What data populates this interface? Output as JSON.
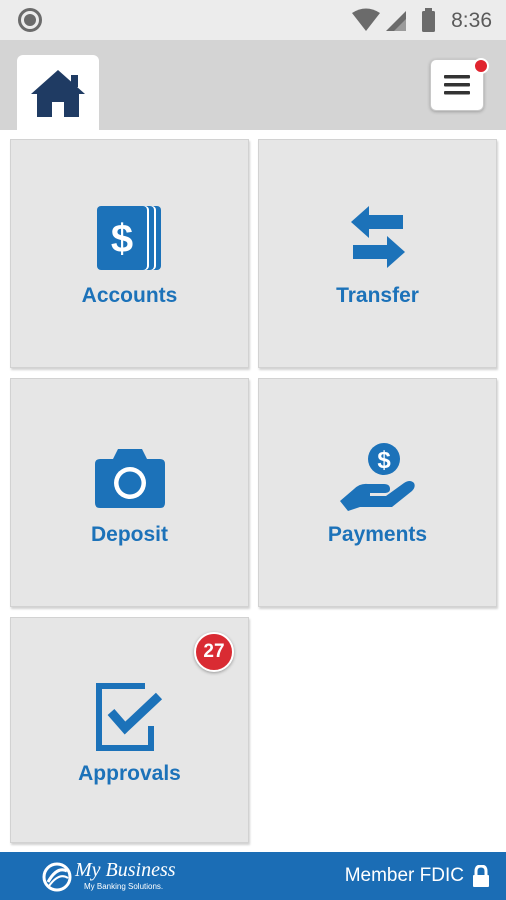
{
  "status_bar": {
    "time": "8:36"
  },
  "nav": {
    "home_icon": "home-icon",
    "menu_icon": "hamburger-menu-icon",
    "menu_notification": true
  },
  "tiles": [
    {
      "label": "Accounts",
      "icon": "dollar-accounts-icon"
    },
    {
      "label": "Transfer",
      "icon": "transfer-arrows-icon"
    },
    {
      "label": "Deposit",
      "icon": "camera-icon"
    },
    {
      "label": "Payments",
      "icon": "hand-dollar-icon"
    },
    {
      "label": "Approvals",
      "icon": "checkbox-icon",
      "badge": "27"
    }
  ],
  "footer": {
    "logo_name": "My Business",
    "logo_tagline": "My Banking Solutions.",
    "member_text": "Member FDIC",
    "lock_icon": "lock-icon"
  },
  "colors": {
    "accent": "#1c72b9",
    "footer": "#1b6db5",
    "badge": "#d92b33",
    "tile": "#e6e6e6"
  }
}
